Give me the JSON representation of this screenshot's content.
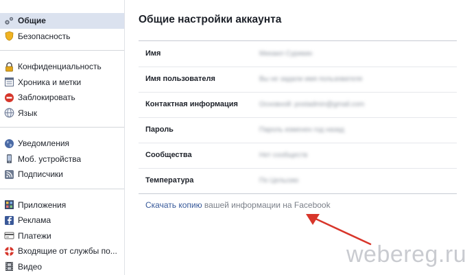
{
  "sidebar": {
    "groups": [
      {
        "items": [
          {
            "label": "Общие",
            "icon": "gears-icon",
            "active": true
          },
          {
            "label": "Безопасность",
            "icon": "shield-icon"
          }
        ]
      },
      {
        "items": [
          {
            "label": "Конфиденциальность",
            "icon": "lock-icon"
          },
          {
            "label": "Хроника и метки",
            "icon": "timeline-icon"
          },
          {
            "label": "Заблокировать",
            "icon": "block-icon"
          },
          {
            "label": "Язык",
            "icon": "globe-icon"
          }
        ]
      },
      {
        "items": [
          {
            "label": "Уведомления",
            "icon": "notifications-globe-icon"
          },
          {
            "label": "Моб. устройства",
            "icon": "mobile-icon"
          },
          {
            "label": "Подписчики",
            "icon": "rss-icon"
          }
        ]
      },
      {
        "items": [
          {
            "label": "Приложения",
            "icon": "apps-icon"
          },
          {
            "label": "Реклама",
            "icon": "ads-icon"
          },
          {
            "label": "Платежи",
            "icon": "payments-icon"
          },
          {
            "label": "Входящие от службы по...",
            "icon": "lifebuoy-icon"
          },
          {
            "label": "Видео",
            "icon": "video-icon"
          }
        ]
      }
    ]
  },
  "main": {
    "title": "Общие настройки аккаунта",
    "rows": [
      {
        "label": "Имя",
        "value": "Михаил Сурикин"
      },
      {
        "label": "Имя пользователя",
        "value": "Вы не задали имя пользователя"
      },
      {
        "label": "Контактная информация",
        "value": "Основной: postadmin@gmail.com"
      },
      {
        "label": "Пароль",
        "value": "Пароль изменен год назад"
      },
      {
        "label": "Сообщества",
        "value": "Нет сообществ"
      },
      {
        "label": "Температура",
        "value": "По Цельсию"
      }
    ],
    "download_link": "Скачать копию",
    "download_rest": " вашей информации на Facebook"
  },
  "watermark": "webereg.ru",
  "colors": {
    "active_bg": "#dbe2ef",
    "link": "#365899",
    "arrow": "#d8362b"
  }
}
